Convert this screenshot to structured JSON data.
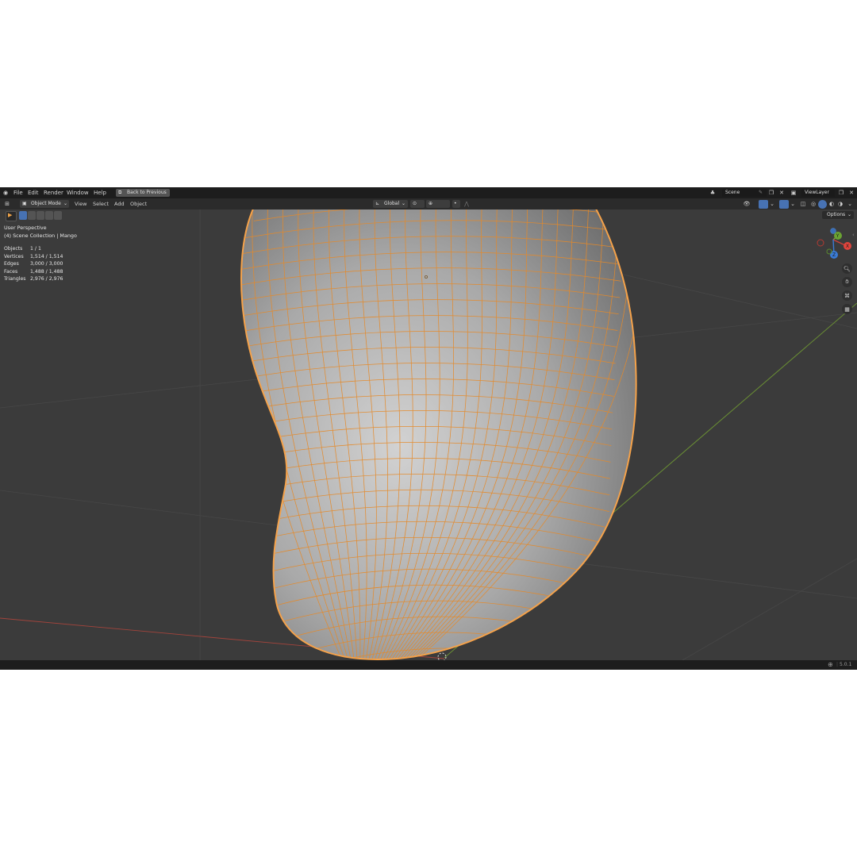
{
  "menu": {
    "items": [
      "File",
      "Edit",
      "Render",
      "Window",
      "Help"
    ],
    "back_to_previous": "Back to Previous",
    "scene": "Scene",
    "view_layer": "ViewLayer"
  },
  "header": {
    "mode": "Object Mode",
    "menus": [
      "View",
      "Select",
      "Add",
      "Object"
    ],
    "transform_orientation": "Global",
    "options": "Options"
  },
  "overlay": {
    "perspective": "User Perspective",
    "collection": "(4) Scene Collection | Mango",
    "stats": [
      {
        "label": "Objects",
        "value": "1 / 1"
      },
      {
        "label": "Vertices",
        "value": "1,514 / 1,514"
      },
      {
        "label": "Edges",
        "value": "3,000 / 3,000"
      },
      {
        "label": "Faces",
        "value": "1,488 / 1,488"
      },
      {
        "label": "Triangles",
        "value": "2,976 / 2,976"
      }
    ]
  },
  "gizmo": {
    "x": "X",
    "y": "Y",
    "z": "Z"
  },
  "status": {
    "version": "5.0.1"
  },
  "colors": {
    "accent": "#f5a24a",
    "axis_x": "#e0443c",
    "axis_y": "#6aa333",
    "axis_z": "#3a7bd5",
    "viewport_bg": "#3b3b3b",
    "wire": "#f0922e"
  }
}
